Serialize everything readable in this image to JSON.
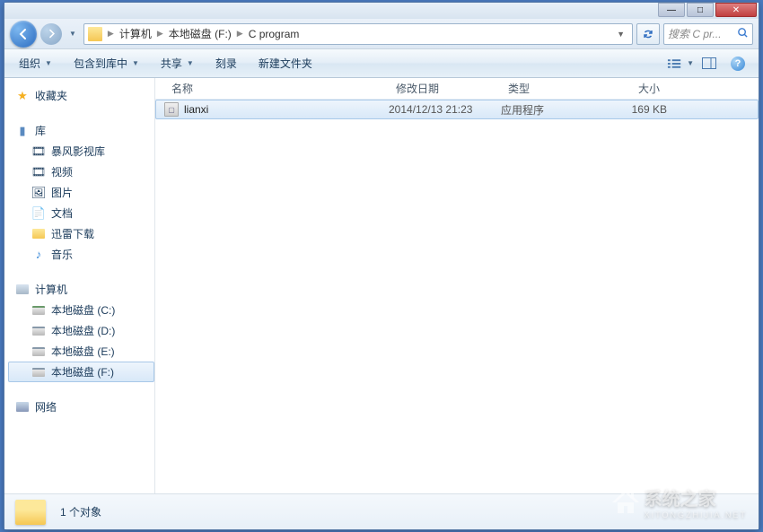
{
  "window_controls": {
    "minimize": "—",
    "maximize": "□",
    "close": "✕"
  },
  "breadcrumbs": {
    "root": "计算机",
    "drive": "本地磁盘 (F:)",
    "folder": "C program"
  },
  "search": {
    "placeholder": "搜索 C pr..."
  },
  "toolbar": {
    "organize": "组织",
    "include": "包含到库中",
    "share": "共享",
    "burn": "刻录",
    "new_folder": "新建文件夹"
  },
  "sidebar": {
    "favorites": "收藏夹",
    "library": "库",
    "lib_items": [
      "暴风影视库",
      "视频",
      "图片",
      "文档",
      "迅雷下载",
      "音乐"
    ],
    "computer": "计算机",
    "drives": [
      "本地磁盘 (C:)",
      "本地磁盘 (D:)",
      "本地磁盘 (E:)",
      "本地磁盘 (F:)"
    ],
    "network": "网络"
  },
  "columns": {
    "name": "名称",
    "date": "修改日期",
    "type": "类型",
    "size": "大小"
  },
  "files": [
    {
      "name": "lianxi",
      "date": "2014/12/13 21:23",
      "type": "应用程序",
      "size": "169 KB"
    }
  ],
  "status": {
    "count": "1 个对象"
  },
  "watermark": {
    "text": "系统之家",
    "sub": "XITONGZHIJIA.NET"
  }
}
